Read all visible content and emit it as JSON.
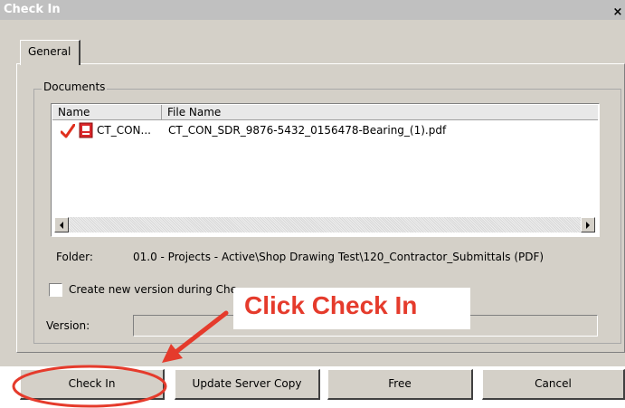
{
  "window": {
    "title": "Check In",
    "close_glyph": "×"
  },
  "tabs": [
    {
      "label": "General"
    }
  ],
  "documents": {
    "group_label": "Documents",
    "columns": [
      "Name",
      "File Name"
    ],
    "rows": [
      {
        "name": "CT_CON...",
        "file_name": "CT_CON_SDR_9876-5432_0156478-Bearing_(1).pdf",
        "status_icon": "red-checkmark-icon",
        "type_icon": "pdf-file-icon"
      }
    ]
  },
  "folder": {
    "label": "Folder:",
    "value": "01.0 - Projects - Active\\Shop Drawing Test\\120_Contractor_Submittals (PDF)"
  },
  "create_version": {
    "label": "Create new version during Check In",
    "checked": false
  },
  "version": {
    "label": "Version:",
    "value": ""
  },
  "annotation": {
    "text": "Click Check In",
    "color": "#e53b2c"
  },
  "buttons": {
    "check_in": "Check In",
    "update_server_copy": "Update Server Copy",
    "free": "Free",
    "cancel": "Cancel"
  },
  "colors": {
    "dialog_face": "#d4d0c8",
    "highlight": "#e53b2c",
    "pdf_icon": "#d9262a"
  }
}
